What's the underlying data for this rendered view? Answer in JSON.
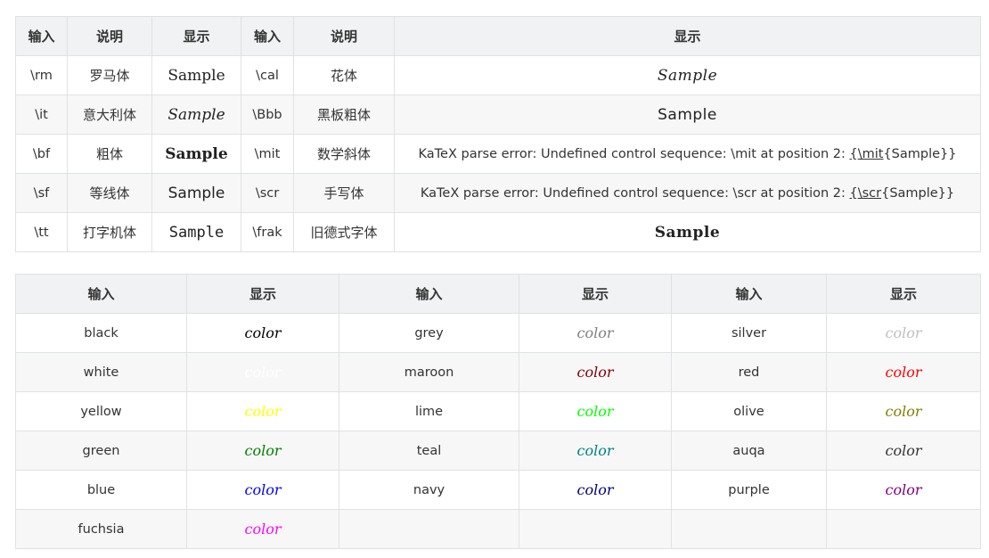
{
  "font_table": {
    "headers": [
      "输入",
      "说明",
      "显示",
      "输入",
      "说明",
      "显示"
    ],
    "rows": [
      {
        "cmd1": "\\rm",
        "desc1": "罗马体",
        "sample1": "Sample",
        "cmd2": "\\cal",
        "desc2": "花体",
        "sample2": "Sample"
      },
      {
        "cmd1": "\\it",
        "desc1": "意大利体",
        "sample1": "Sample",
        "cmd2": "\\Bbb",
        "desc2": "黑板粗体",
        "sample2": "Sample"
      },
      {
        "cmd1": "\\bf",
        "desc1": "粗体",
        "sample1": "Sample",
        "cmd2": "\\mit",
        "desc2": "数学斜体",
        "err_prefix": "KaTeX parse error: Undefined control sequence: \\mit at position 2: ",
        "err_open": "{",
        "err_cmd": "\\mit",
        "err_close": "{Sample}}"
      },
      {
        "cmd1": "\\sf",
        "desc1": "等线体",
        "sample1": "Sample",
        "cmd2": "\\scr",
        "desc2": "手写体",
        "err_prefix": "KaTeX parse error: Undefined control sequence: \\scr at position 2: ",
        "err_open": "{",
        "err_cmd": "\\scr",
        "err_close": "{Sample}}"
      },
      {
        "cmd1": "\\tt",
        "desc1": "打字机体",
        "sample1": "Sample",
        "cmd2": "\\frak",
        "desc2": "旧德式字体",
        "sample2": "Sample"
      }
    ]
  },
  "color_table": {
    "headers": [
      "输入",
      "显示",
      "输入",
      "显示",
      "输入",
      "显示"
    ],
    "word": "color",
    "rows": [
      [
        {
          "name": "black",
          "hex": "#000000"
        },
        {
          "name": "grey",
          "hex": "#808080"
        },
        {
          "name": "silver",
          "hex": "#c0c0c0"
        }
      ],
      [
        {
          "name": "white",
          "hex": "#ffffff"
        },
        {
          "name": "maroon",
          "hex": "#800000"
        },
        {
          "name": "red",
          "hex": "#ff0000"
        }
      ],
      [
        {
          "name": "yellow",
          "hex": "#ffff00"
        },
        {
          "name": "lime",
          "hex": "#00ff00"
        },
        {
          "name": "olive",
          "hex": "#808000"
        }
      ],
      [
        {
          "name": "green",
          "hex": "#008000"
        },
        {
          "name": "teal",
          "hex": "#008080"
        },
        {
          "name": "auqa",
          "hex": "#333333"
        }
      ],
      [
        {
          "name": "blue",
          "hex": "#0000ff"
        },
        {
          "name": "navy",
          "hex": "#000080"
        },
        {
          "name": "purple",
          "hex": "#800080"
        }
      ],
      [
        {
          "name": "fuchsia",
          "hex": "#ff00ff"
        }
      ]
    ]
  }
}
